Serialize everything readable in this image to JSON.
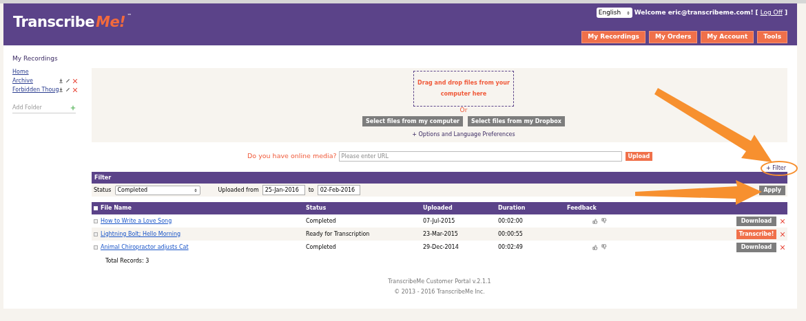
{
  "header": {
    "logo": {
      "main": "Transcribe",
      "accent": "Me!",
      "mark": "™"
    },
    "language": "English",
    "welcome": "Welcome eric@transcribeme.com!",
    "logoff_open": "[",
    "logoff": "Log Off",
    "logoff_close": "]",
    "nav": [
      {
        "label": "My Recordings",
        "selected": false
      },
      {
        "label": "My Orders",
        "selected": false
      },
      {
        "label": "My Account",
        "selected": false
      },
      {
        "label": "Tools",
        "selected": false
      }
    ]
  },
  "sidebar": {
    "title": "My Recordings",
    "folders": [
      {
        "label": "Home",
        "editable": false
      },
      {
        "label": "Archive",
        "editable": true
      },
      {
        "label": "Forbidden Thoug",
        "editable": true
      }
    ],
    "add_folder": "Add Folder"
  },
  "upload": {
    "drop": "Drag and drop files from your computer here",
    "or": "Or",
    "buttons": [
      "Select files from my computer",
      "Select files from my Dropbox"
    ],
    "options": "+ Options and Language Preferences"
  },
  "online_media": {
    "label": "Do you have online media?",
    "placeholder": "Please enter URL",
    "button": "Upload"
  },
  "filter_toggle": "+ Filter",
  "filter": {
    "title": "Filter",
    "status_label": "Status",
    "status": "Completed",
    "from_label": "Uploaded from",
    "from": "25-Jan-2016",
    "to_label": "to",
    "to": "02-Feb-2016",
    "apply": "Apply"
  },
  "table": {
    "all_checked": false,
    "columns": [
      "File Name",
      "Status",
      "Uploaded",
      "Duration",
      "Feedback"
    ],
    "rows": [
      {
        "name": "How to Write a Love Song",
        "status": "Completed",
        "uploaded": "07-Jul-2015",
        "duration": "00:02:00",
        "checked": false,
        "feedback": true,
        "action": {
          "label": "Download",
          "kind": "download"
        }
      },
      {
        "name": "Lightning Bolt; Hello Morning",
        "status": "Ready for Transcription",
        "uploaded": "23-Mar-2015",
        "duration": "00:00:55",
        "checked": false,
        "feedback": false,
        "action": {
          "label": "Transcribe!",
          "kind": "transcribe"
        }
      },
      {
        "name": "Animal Chiropractor adjusts Cat",
        "status": "Completed",
        "uploaded": "29-Dec-2014",
        "duration": "00:02:49",
        "checked": false,
        "feedback": true,
        "action": {
          "label": "Download",
          "kind": "download"
        }
      }
    ],
    "total": "Total Records: 3"
  },
  "footer": [
    "TranscribeMe Customer Portal v.2.1.1",
    "© 2013 - 2016 TranscribeMe Inc."
  ]
}
